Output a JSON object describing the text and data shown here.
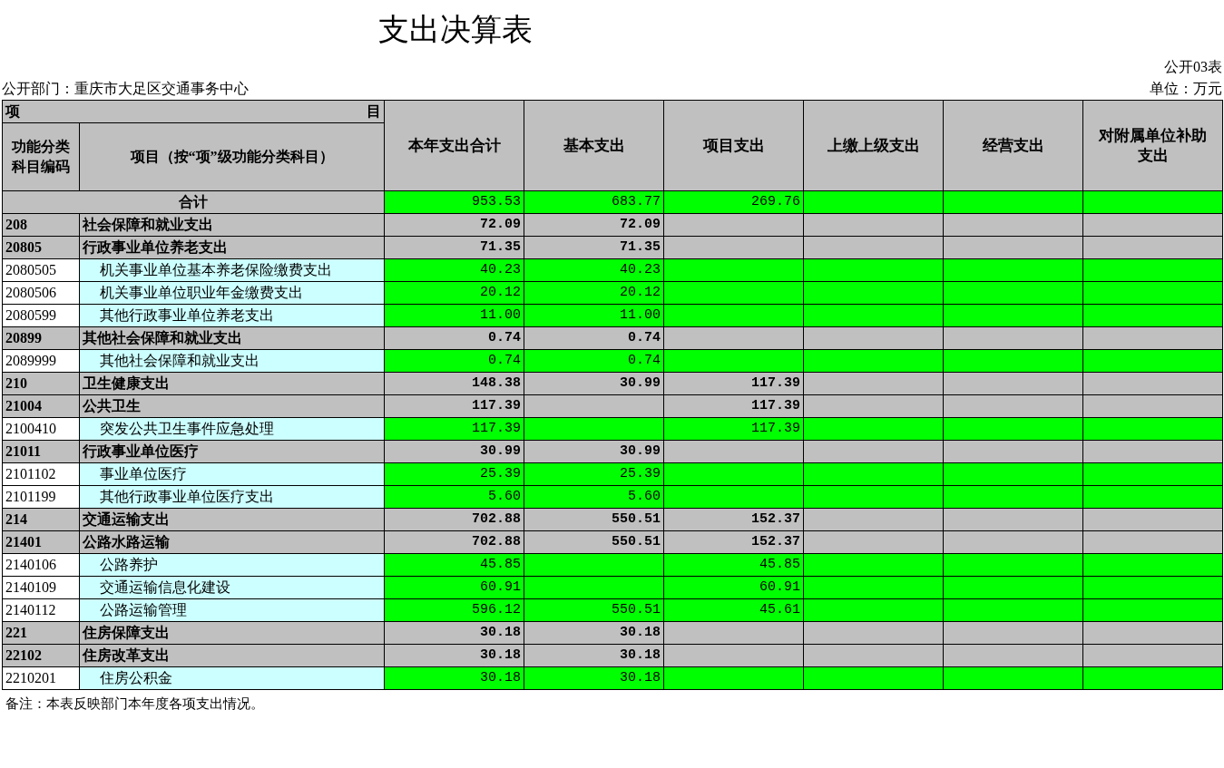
{
  "title": "支出决算表",
  "form_no": "公开03表",
  "department": "公开部门：重庆市大足区交通事务中心",
  "unit": "单位：万元",
  "header": {
    "top_left": "项",
    "top_right": "目",
    "code_label": "功能分类科目编码",
    "name_label": "项目（按“项”级功能分类科目）",
    "columns": [
      "本年支出合计",
      "基本支出",
      "项目支出",
      "上缴上级支出",
      "经营支出",
      "对附属单位补助支出"
    ]
  },
  "rows": [
    {
      "kind": "total",
      "name": "合计",
      "total_expense": "953.53",
      "basic_expense": "683.77",
      "project_expense": "269.76"
    },
    {
      "kind": "group",
      "code": "208",
      "name": "社会保障和就业支出",
      "total_expense": "72.09",
      "basic_expense": "72.09"
    },
    {
      "kind": "group",
      "code": "20805",
      "name": "行政事业单位养老支出",
      "total_expense": "71.35",
      "basic_expense": "71.35"
    },
    {
      "kind": "item",
      "code": "2080505",
      "name": "机关事业单位基本养老保险缴费支出",
      "total_expense": "40.23",
      "basic_expense": "40.23"
    },
    {
      "kind": "item",
      "code": "2080506",
      "name": "机关事业单位职业年金缴费支出",
      "total_expense": "20.12",
      "basic_expense": "20.12"
    },
    {
      "kind": "item",
      "code": "2080599",
      "name": "其他行政事业单位养老支出",
      "total_expense": "11.00",
      "basic_expense": "11.00"
    },
    {
      "kind": "group",
      "code": "20899",
      "name": "其他社会保障和就业支出",
      "total_expense": "0.74",
      "basic_expense": "0.74"
    },
    {
      "kind": "item",
      "code": "2089999",
      "name": "其他社会保障和就业支出",
      "total_expense": "0.74",
      "basic_expense": "0.74"
    },
    {
      "kind": "group",
      "code": "210",
      "name": "卫生健康支出",
      "total_expense": "148.38",
      "basic_expense": "30.99",
      "project_expense": "117.39"
    },
    {
      "kind": "group",
      "code": "21004",
      "name": "公共卫生",
      "total_expense": "117.39",
      "project_expense": "117.39"
    },
    {
      "kind": "item",
      "code": "2100410",
      "name": "突发公共卫生事件应急处理",
      "total_expense": "117.39",
      "project_expense": "117.39"
    },
    {
      "kind": "group",
      "code": "21011",
      "name": "行政事业单位医疗",
      "total_expense": "30.99",
      "basic_expense": "30.99"
    },
    {
      "kind": "item",
      "code": "2101102",
      "name": "事业单位医疗",
      "total_expense": "25.39",
      "basic_expense": "25.39"
    },
    {
      "kind": "item",
      "code": "2101199",
      "name": "其他行政事业单位医疗支出",
      "total_expense": "5.60",
      "basic_expense": "5.60"
    },
    {
      "kind": "group",
      "code": "214",
      "name": "交通运输支出",
      "total_expense": "702.88",
      "basic_expense": "550.51",
      "project_expense": "152.37"
    },
    {
      "kind": "group",
      "code": "21401",
      "name": "公路水路运输",
      "total_expense": "702.88",
      "basic_expense": "550.51",
      "project_expense": "152.37"
    },
    {
      "kind": "item",
      "code": "2140106",
      "name": "公路养护",
      "total_expense": "45.85",
      "project_expense": "45.85"
    },
    {
      "kind": "item",
      "code": "2140109",
      "name": "交通运输信息化建设",
      "total_expense": "60.91",
      "project_expense": "60.91"
    },
    {
      "kind": "item",
      "code": "2140112",
      "name": "公路运输管理",
      "total_expense": "596.12",
      "basic_expense": "550.51",
      "project_expense": "45.61"
    },
    {
      "kind": "group",
      "code": "221",
      "name": "住房保障支出",
      "total_expense": "30.18",
      "basic_expense": "30.18"
    },
    {
      "kind": "group",
      "code": "22102",
      "name": "住房改革支出",
      "total_expense": "30.18",
      "basic_expense": "30.18"
    },
    {
      "kind": "item",
      "code": "2210201",
      "name": "住房公积金",
      "total_expense": "30.18",
      "basic_expense": "30.18"
    }
  ],
  "note": "备注：本表反映部门本年度各项支出情况。"
}
